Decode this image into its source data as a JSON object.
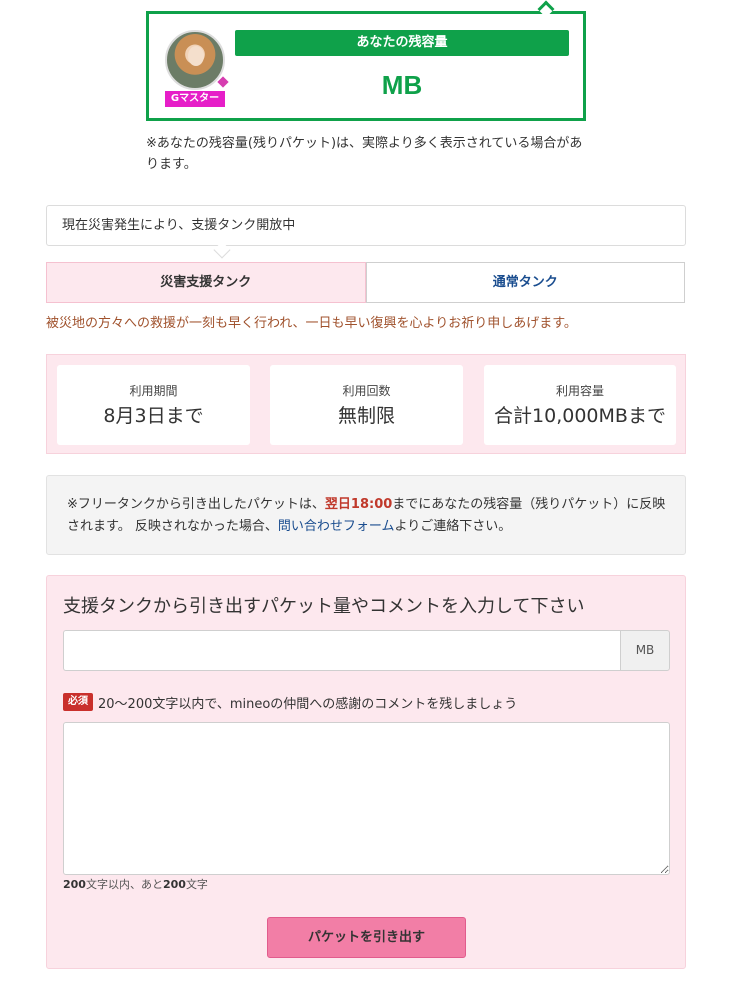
{
  "capacity": {
    "header": "あなたの残容量",
    "value": "",
    "unit": "MB",
    "rank_badge": "Gマスター",
    "note": "※あなたの残容量(残りパケット)は、実際より多く表示されている場合があります。"
  },
  "disaster": {
    "notice": "現在災害発生により、支援タンク開放中",
    "prayer": "被災地の方々への救援が一刻も早く行われ、一日も早い復興を心よりお祈り申しあげます。"
  },
  "tabs": {
    "active": "災害支援タンク",
    "normal": "通常タンク"
  },
  "info": [
    {
      "label": "利用期間",
      "value": "8月3日まで"
    },
    {
      "label": "利用回数",
      "value": "無制限"
    },
    {
      "label": "利用容量",
      "value": "合計10,000MBまで"
    }
  ],
  "reflect_note": {
    "text_before": "※フリータンクから引き出したパケットは、",
    "time": "翌日18:00",
    "text_middle": "までにあなたの残容量（残りパケット）に反映されます。 反映されなかった場合、",
    "link": "問い合わせフォーム",
    "text_after": "よりご連絡下さい。"
  },
  "form": {
    "title": "支援タンクから引き出すパケット量やコメントを入力して下さい",
    "packet_value": "",
    "unit": "MB",
    "required_badge": "必須",
    "required_text": "20〜200文字以内で、mineoの仲間への感謝のコメントを残しましょう",
    "comment_value": "",
    "count_limit": "200",
    "count_mid": "文字以内、あと",
    "count_remaining": "200",
    "count_suffix": "文字",
    "submit_label": "パケットを引き出す"
  },
  "colors": {
    "accent_green": "#0fa14a",
    "pink_bg": "#fde8ee",
    "button_pink": "#f27ea6",
    "link_blue": "#1a4d8f",
    "badge_magenta": "#e61ec8"
  }
}
